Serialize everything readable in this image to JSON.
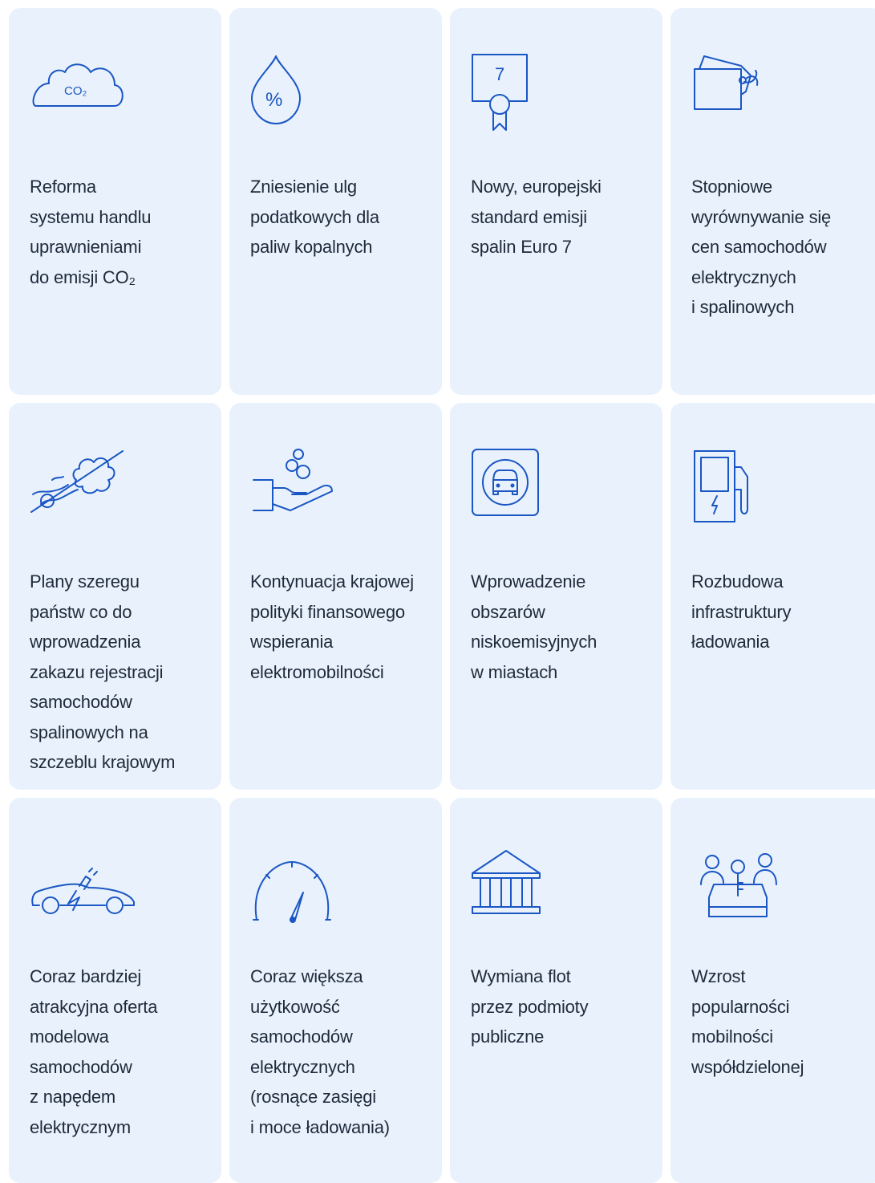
{
  "accent_color": "#1a56c4",
  "card_color": "#e9f2fc",
  "cards": [
    {
      "icon": "co2-cloud-icon",
      "icon_text": "CO₂",
      "label": "Reforma\nsystemu handlu\nuprawnieniami\ndo emisji CO₂"
    },
    {
      "icon": "percent-drop-icon",
      "icon_text": "%",
      "label": "Zniesienie ulg\npodatkowych dla\npaliw kopalnych"
    },
    {
      "icon": "euro7-certificate-icon",
      "icon_text": "7",
      "label": "Nowy, europejski\nstandard emisji\nspalin Euro 7"
    },
    {
      "icon": "price-tag-icon",
      "label": "Stopniowe\nwyrównywanie się\ncen samochodów\nelektrycznych\ni spalinowych"
    },
    {
      "icon": "no-exhaust-icon",
      "label": "Plany szeregu\npaństw co do\nwprowadzenia\nzakazu rejestracji\nsamochodów\nspalinowych na\nszczeblu krajowym"
    },
    {
      "icon": "hand-coins-icon",
      "label": "Kontynuacja krajowej\npolityki finansowego\nwspierania\nelektromobilności"
    },
    {
      "icon": "low-emission-zone-sign-icon",
      "label": "Wprowadzenie\nobszarów\nniskoemisyjnych\nw miastach"
    },
    {
      "icon": "charging-station-icon",
      "label": "Rozbudowa\ninfrastruktury\nładowania"
    },
    {
      "icon": "electric-car-icon",
      "label": "Coraz bardziej\natrakcyjna oferta\nmodelowa\nsamochodów\nz napędem\nelektrycznym"
    },
    {
      "icon": "speedometer-icon",
      "label": "Coraz większa\nużytkowość\nsamochodów\nelektrycznych\n(rosnące zasięgi\ni moce ładowania)"
    },
    {
      "icon": "public-building-icon",
      "label": "Wymiana flot\nprzez podmioty\npubliczne"
    },
    {
      "icon": "car-sharing-icon",
      "label": "Wzrost\npopularności\nmobilności\nwspółdzielonej"
    }
  ]
}
